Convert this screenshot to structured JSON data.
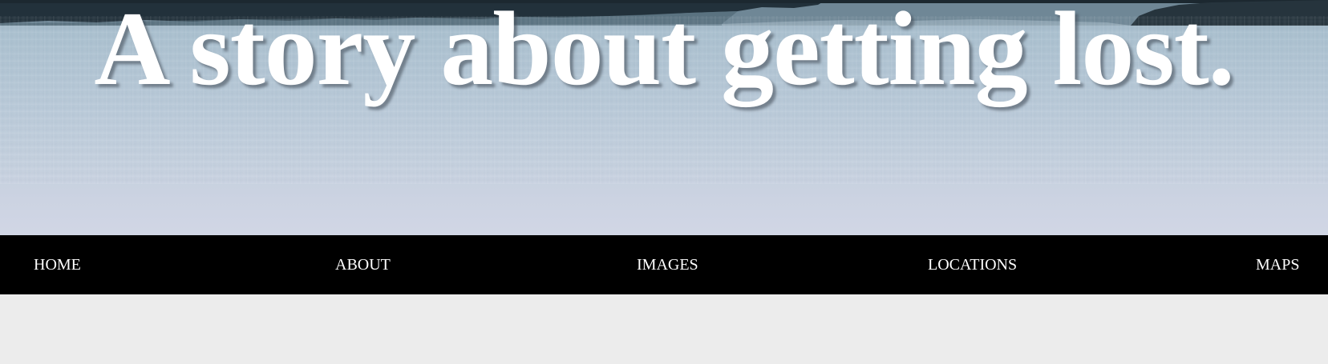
{
  "hero": {
    "title": "A story about getting lost.",
    "background_image": "ocean-water-with-rocky-shoreline"
  },
  "nav": {
    "items": [
      {
        "label": "HOME"
      },
      {
        "label": "ABOUT"
      },
      {
        "label": "IMAGES"
      },
      {
        "label": "LOCATIONS"
      },
      {
        "label": "MAPS"
      }
    ]
  },
  "colors": {
    "nav_background": "#000000",
    "nav_text": "#ffffff",
    "page_background": "#ececec",
    "title_text": "#ffffff"
  }
}
